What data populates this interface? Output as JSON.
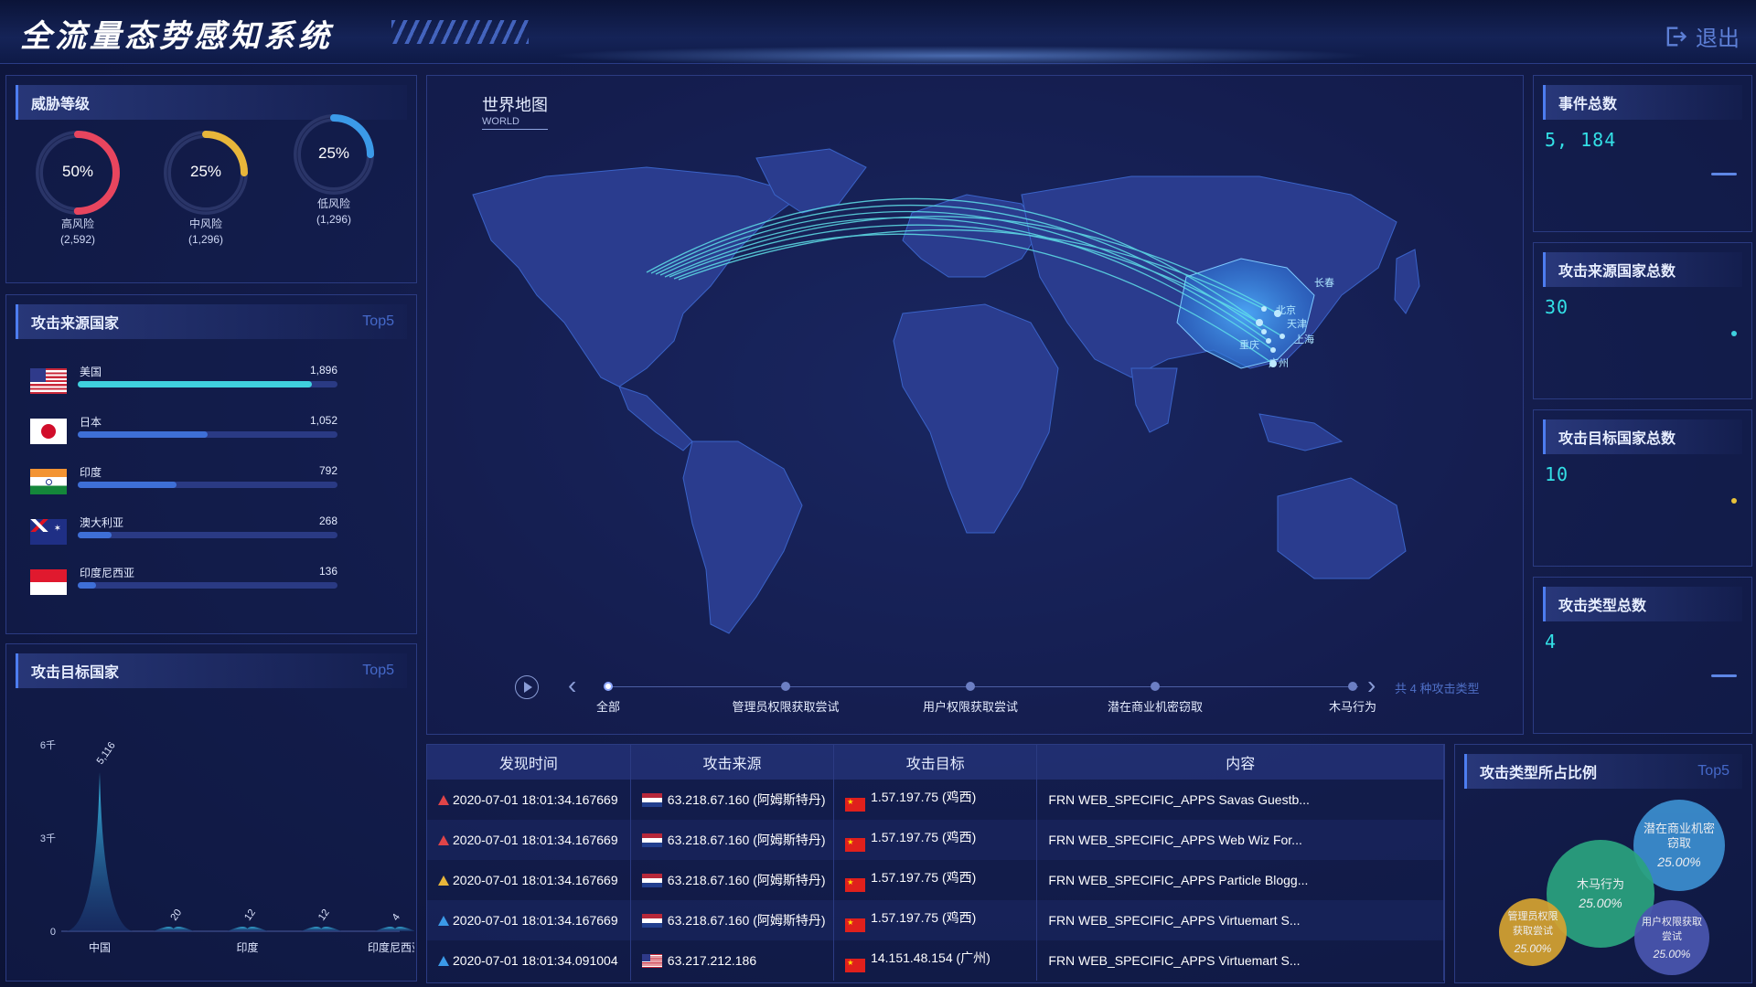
{
  "header": {
    "title": "全流量态势感知系统",
    "logout_label": "退出"
  },
  "threat": {
    "title": "威胁等级",
    "items": [
      {
        "label": "高风险",
        "count": "(2,592)",
        "pct": "50%",
        "value": 0.5,
        "color": "#e8455e"
      },
      {
        "label": "中风险",
        "count": "(1,296)",
        "pct": "25%",
        "value": 0.25,
        "color": "#e8b63a"
      },
      {
        "label": "低风险",
        "count": "(1,296)",
        "pct": "25%",
        "value": 0.25,
        "color": "#3b9ae8"
      }
    ]
  },
  "source": {
    "title": "攻击来源国家",
    "top5": "Top5",
    "items": [
      {
        "name": "美国",
        "value": "1,896",
        "fill": 0.9,
        "color": "#3fd0de",
        "flag": "us"
      },
      {
        "name": "日本",
        "value": "1,052",
        "fill": 0.5,
        "color": "#3e6fd6",
        "flag": "jp"
      },
      {
        "name": "印度",
        "value": "792",
        "fill": 0.38,
        "color": "#3e6fd6",
        "flag": "in"
      },
      {
        "name": "澳大利亚",
        "value": "268",
        "fill": 0.13,
        "color": "#3e6fd6",
        "flag": "au"
      },
      {
        "name": "印度尼西亚",
        "value": "136",
        "fill": 0.07,
        "color": "#3e6fd6",
        "flag": "id"
      }
    ]
  },
  "target": {
    "title": "攻击目标国家",
    "top5": "Top5"
  },
  "chart_data": {
    "type": "area",
    "categories": [
      "中国",
      "",
      "印度",
      "",
      "印度尼西亚"
    ],
    "values": [
      5116,
      20,
      12,
      12,
      4
    ],
    "value_labels": [
      "5,116",
      "20",
      "12",
      "12",
      "4"
    ],
    "yticks": [
      "0",
      "3千",
      "6千"
    ],
    "ylim": [
      0,
      6000
    ],
    "color": "#37b8e0"
  },
  "map": {
    "title_cn": "世界地图",
    "title_en": "WORLD",
    "timeline": [
      "全部",
      "管理员权限获取尝试",
      "用户权限获取尝试",
      "潜在商业机密窃取",
      "木马行为"
    ],
    "summary": "共 4 种攻击类型",
    "city_labels": [
      "北京",
      "天津",
      "重庆",
      "上海",
      "广州",
      "长春"
    ]
  },
  "stats": [
    {
      "title": "事件总数",
      "value": "5, 184"
    },
    {
      "title": "攻击来源国家总数",
      "value": "30"
    },
    {
      "title": "攻击目标国家总数",
      "value": "10"
    },
    {
      "title": "攻击类型总数",
      "value": "4"
    }
  ],
  "table": {
    "headers": [
      "发现时间",
      "攻击来源",
      "攻击目标",
      "内容"
    ],
    "rows": [
      {
        "time": "2020-07-01 18:01:34.167669",
        "src": "63.218.67.160 (阿姆斯特丹)",
        "dst": "1.57.197.75 (鸡西)",
        "content": "FRN WEB_SPECIFIC_APPS Savas Guestb...",
        "warn": "#e04448",
        "srcflag": "nl"
      },
      {
        "time": "2020-07-01 18:01:34.167669",
        "src": "63.218.67.160 (阿姆斯特丹)",
        "dst": "1.57.197.75 (鸡西)",
        "content": "FRN WEB_SPECIFIC_APPS Web Wiz For...",
        "warn": "#e04448",
        "srcflag": "nl"
      },
      {
        "time": "2020-07-01 18:01:34.167669",
        "src": "63.218.67.160 (阿姆斯特丹)",
        "dst": "1.57.197.75 (鸡西)",
        "content": "FRN WEB_SPECIFIC_APPS Particle Blogg...",
        "warn": "#e8b63a",
        "srcflag": "nl"
      },
      {
        "time": "2020-07-01 18:01:34.167669",
        "src": "63.218.67.160 (阿姆斯特丹)",
        "dst": "1.57.197.75 (鸡西)",
        "content": "FRN WEB_SPECIFIC_APPS Virtuemart S...",
        "warn": "#3b9ae8",
        "srcflag": "nl"
      },
      {
        "time": "2020-07-01 18:01:34.091004",
        "src": "63.217.212.186",
        "dst": "14.151.48.154 (广州)",
        "content": "FRN WEB_SPECIFIC_APPS Virtuemart S...",
        "warn": "#3b9ae8",
        "srcflag": "us"
      }
    ]
  },
  "ratio": {
    "title": "攻击类型所占比例",
    "top5": "Top5",
    "bubbles": [
      {
        "label": "潜在商业机密窃取",
        "pct": "25.00%",
        "color": "#3c8fd0"
      },
      {
        "label": "木马行为",
        "pct": "25.00%",
        "color": "#2aa37f"
      },
      {
        "label": "管理员权限获取尝试",
        "pct": "25.00%",
        "color": "#d6a331"
      },
      {
        "label": "用户权限获取尝试",
        "pct": "25.00%",
        "color": "#4a56b0"
      }
    ]
  }
}
